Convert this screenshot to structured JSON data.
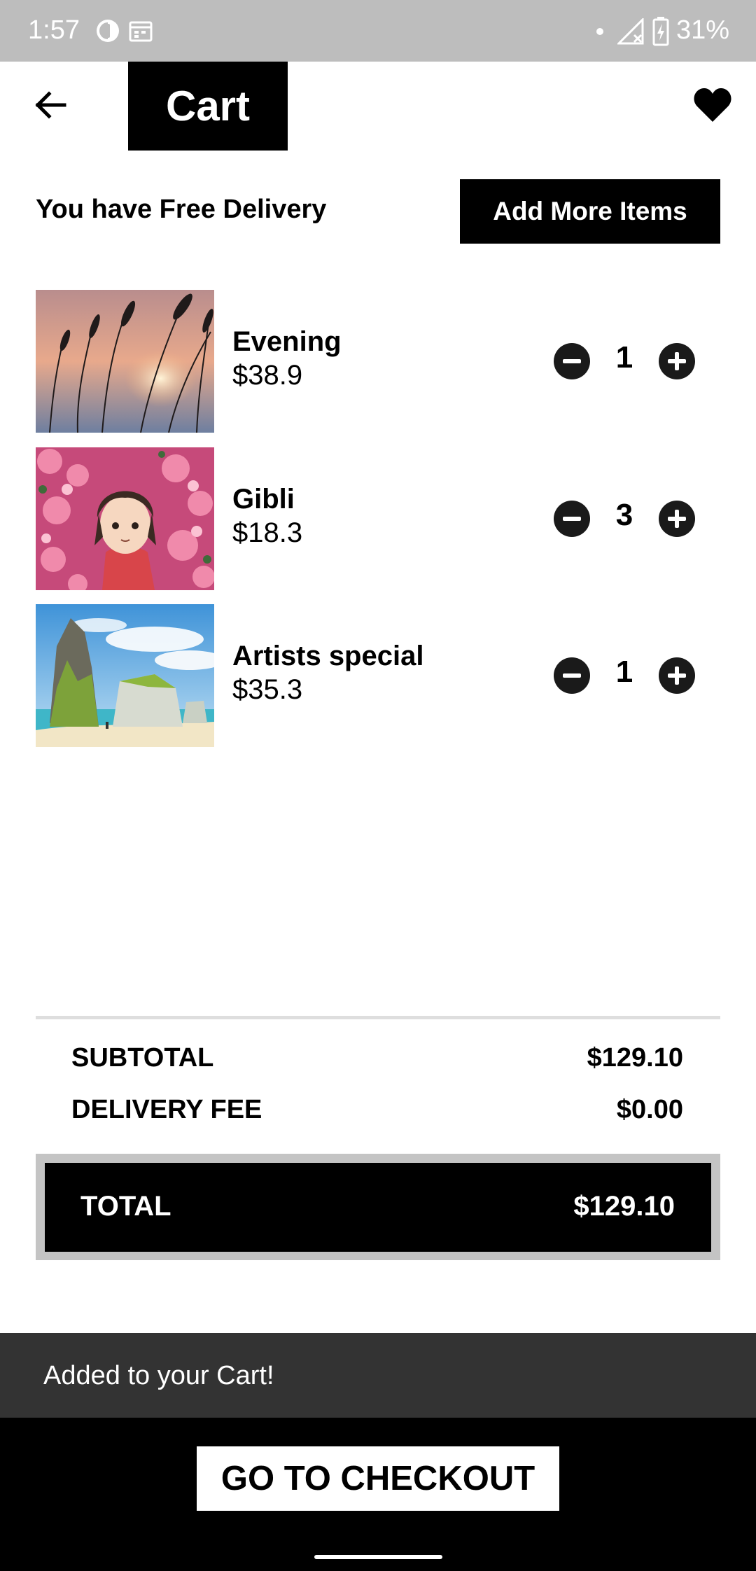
{
  "status_bar": {
    "time": "1:57",
    "battery": "31%"
  },
  "header": {
    "title": "Cart",
    "back_icon": "arrow-left-icon",
    "favorite_icon": "heart-icon"
  },
  "delivery": {
    "message": "You have Free Delivery",
    "add_more_label": "Add More Items"
  },
  "items": [
    {
      "name": "Evening",
      "price": "$38.9",
      "quantity": "1",
      "image": "sunset-grass-photo"
    },
    {
      "name": "Gibli",
      "price": "$18.3",
      "quantity": "3",
      "image": "anime-girl-flowers"
    },
    {
      "name": "Artists special",
      "price": "$35.3",
      "quantity": "1",
      "image": "coastal-landscape-painting"
    }
  ],
  "summary": {
    "subtotal_label": "SUBTOTAL",
    "subtotal_value": "$129.10",
    "delivery_label": "DELIVERY FEE",
    "delivery_value": "$0.00",
    "total_label": "TOTAL",
    "total_value": "$129.10"
  },
  "snackbar": {
    "message": "Added to your Cart!"
  },
  "checkout": {
    "label": "GO TO CHECKOUT"
  },
  "colors": {
    "primary": "#000000",
    "status_bar": "#bdbdbd",
    "snackbar": "#333333",
    "total_border": "#c4c4c4"
  }
}
